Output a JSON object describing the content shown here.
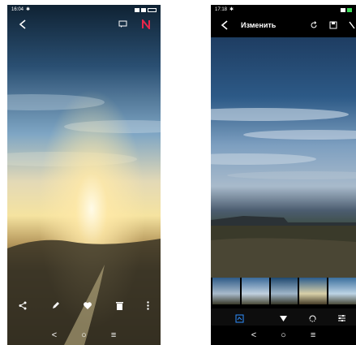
{
  "viewer": {
    "status": {
      "time": "16:04"
    },
    "icons": [
      "back-arrow-icon",
      "chat-icon",
      "n-logo-icon",
      "share-icon",
      "edit-pencil-icon",
      "heart-icon",
      "trash-icon",
      "more-vertical-icon"
    ]
  },
  "editor": {
    "status": {
      "time": "17:18"
    },
    "header": {
      "title": "Изменить"
    },
    "filters": [
      {
        "label": ""
      },
      {
        "label": ""
      },
      {
        "label": ""
      },
      {
        "label": ""
      },
      {
        "label": ""
      }
    ],
    "accent": "#2f8fff"
  },
  "nav": {
    "back": "<",
    "home": "○",
    "menu": "≡"
  }
}
